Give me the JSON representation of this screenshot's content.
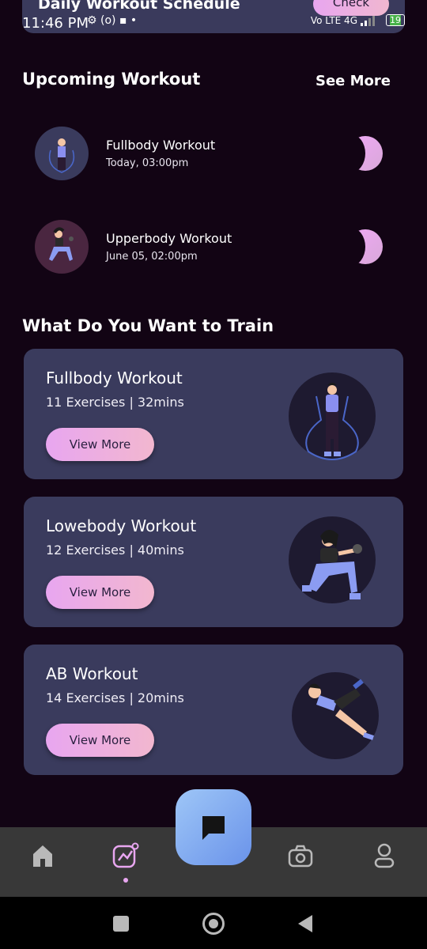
{
  "status_bar": {
    "time": "11:46 PM",
    "icons_left": "⚙ (o) ▪ •",
    "network": "Vo LTE 4G",
    "battery": "19"
  },
  "top_card": {
    "title": "Daily Workout Schedule",
    "button_label": "Check"
  },
  "upcoming": {
    "title": "Upcoming Workout",
    "see_more": "See More",
    "items": [
      {
        "title": "Fullbody Workout",
        "time": "Today, 03:00pm"
      },
      {
        "title": "Upperbody Workout",
        "time": "June 05, 02:00pm"
      }
    ]
  },
  "train": {
    "title": "What Do You Want to Train",
    "cards": [
      {
        "title": "Fullbody Workout",
        "subtitle": "11 Exercises | 32mins",
        "button_label": "View More"
      },
      {
        "title": "Lowebody Workout",
        "subtitle": "12 Exercises | 40mins",
        "button_label": "View More"
      },
      {
        "title": "AB Workout",
        "subtitle": "14 Exercises | 20mins",
        "button_label": "View More"
      }
    ]
  },
  "nav": {
    "items": [
      "home-icon",
      "activity-icon",
      "chat-icon",
      "camera-icon",
      "profile-icon"
    ]
  },
  "colors": {
    "accent": "#E8A6F0",
    "card": "#3A3B5D",
    "background": "#120414",
    "fab": "#7FA5F0"
  }
}
